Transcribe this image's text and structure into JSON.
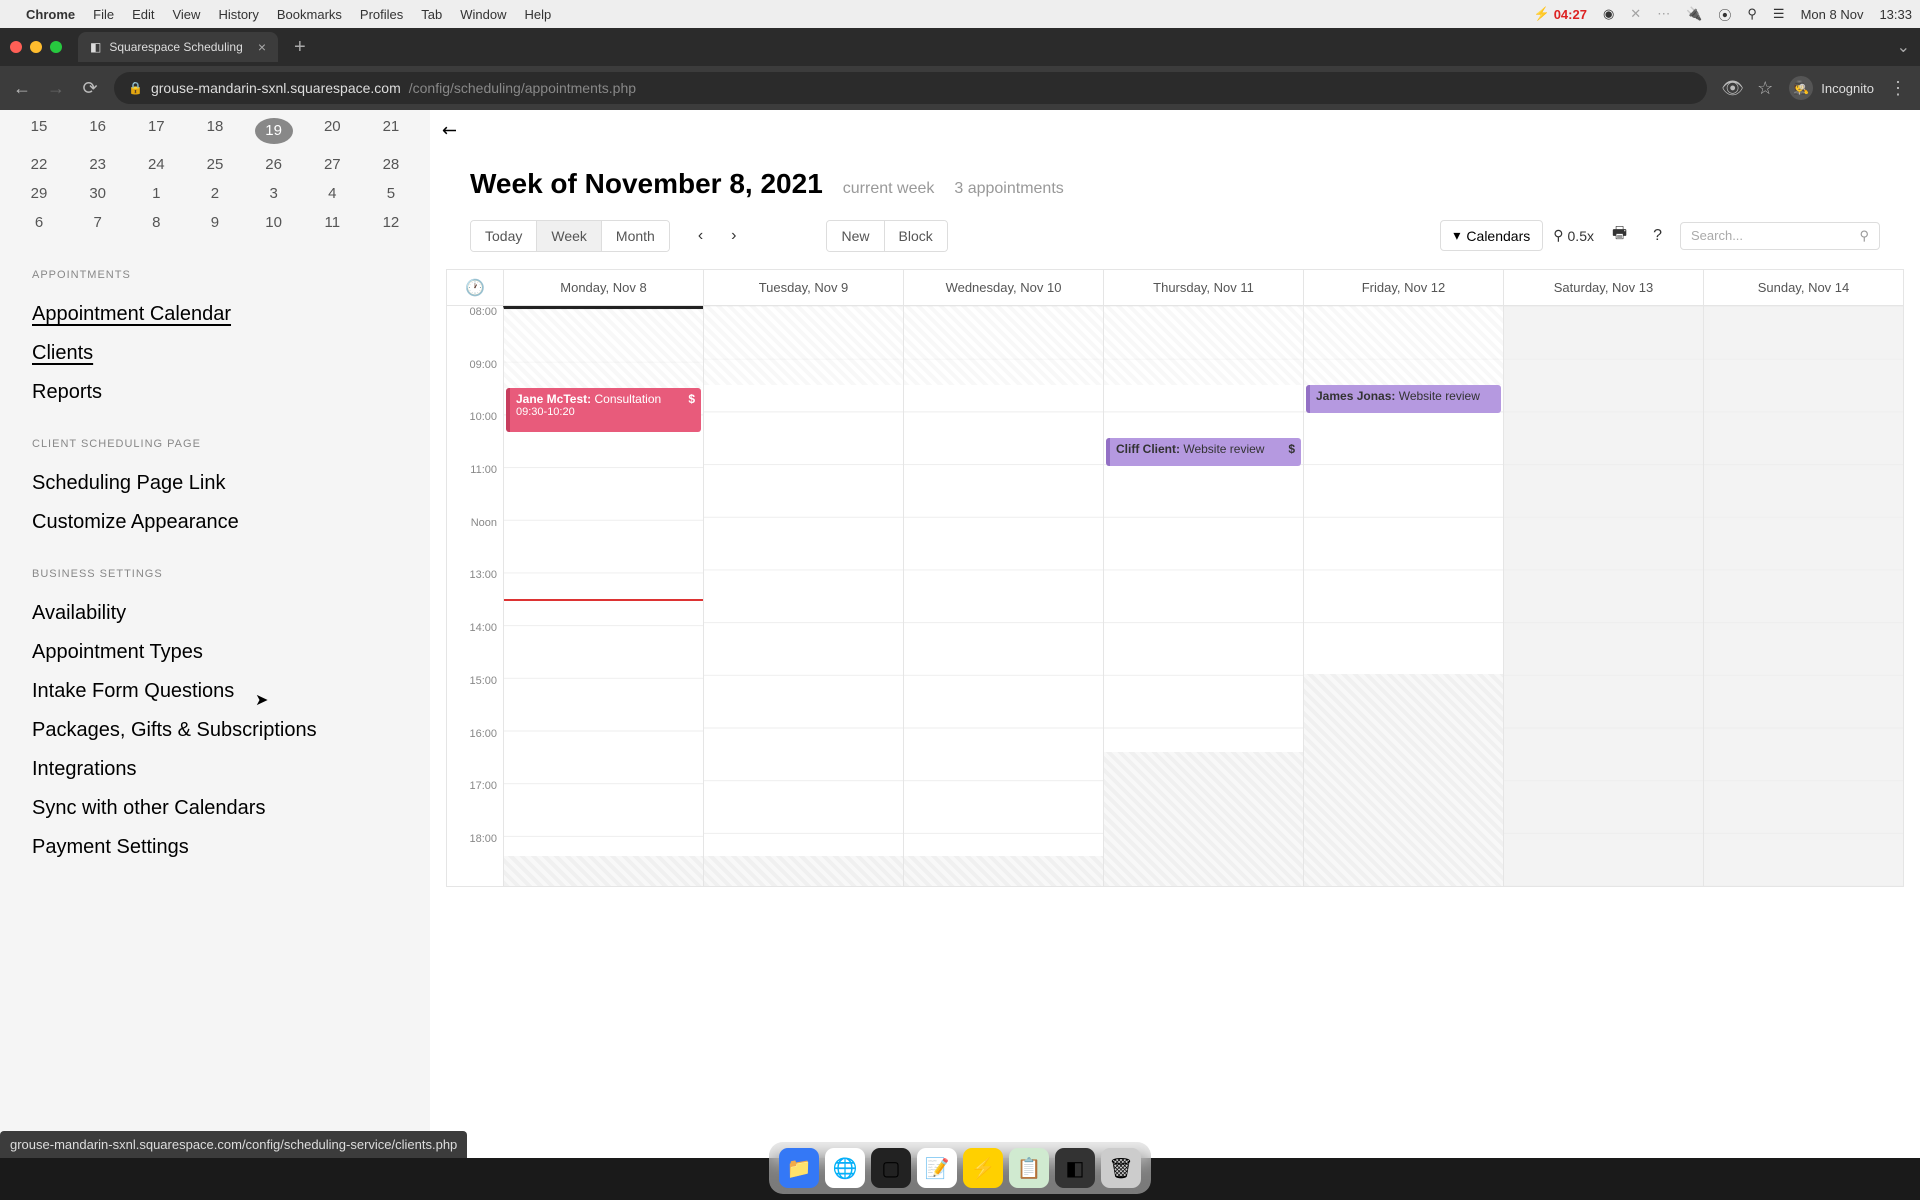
{
  "menubar": {
    "app": "Chrome",
    "items": [
      "File",
      "Edit",
      "View",
      "History",
      "Bookmarks",
      "Profiles",
      "Tab",
      "Window",
      "Help"
    ],
    "battery_time": "04:27",
    "date": "Mon 8 Nov",
    "clock": "13:33"
  },
  "browser": {
    "tab_title": "Squarespace Scheduling",
    "url_host": "grouse-mandarin-sxnl.squarespace.com",
    "url_path": "/config/scheduling/appointments.php",
    "incognito_label": "Incognito",
    "status_url": "grouse-mandarin-sxnl.squarespace.com/config/scheduling-service/clients.php"
  },
  "sidebar": {
    "mini_cal": [
      [
        "15",
        "16",
        "17",
        "18",
        "19",
        "20",
        "21"
      ],
      [
        "22",
        "23",
        "24",
        "25",
        "26",
        "27",
        "28"
      ],
      [
        "29",
        "30",
        "1",
        "2",
        "3",
        "4",
        "5"
      ],
      [
        "6",
        "7",
        "8",
        "9",
        "10",
        "11",
        "12"
      ]
    ],
    "mini_cal_today": "19",
    "sections": [
      {
        "title": "APPOINTMENTS",
        "items": [
          "Appointment Calendar",
          "Clients",
          "Reports"
        ]
      },
      {
        "title": "CLIENT SCHEDULING PAGE",
        "items": [
          "Scheduling Page Link",
          "Customize Appearance"
        ]
      },
      {
        "title": "BUSINESS SETTINGS",
        "items": [
          "Availability",
          "Appointment Types",
          "Intake Form Questions",
          "Packages, Gifts & Subscriptions",
          "Integrations",
          "Sync with other Calendars",
          "Payment Settings"
        ]
      }
    ],
    "active": [
      "Appointment Calendar",
      "Clients"
    ]
  },
  "main": {
    "title": "Week of November 8, 2021",
    "subtitle_current": "current week",
    "subtitle_count": "3 appointments",
    "toolbar": {
      "today": "Today",
      "week": "Week",
      "month": "Month",
      "new": "New",
      "block": "Block",
      "calendars": "Calendars",
      "zoom": "0.5x",
      "search_placeholder": "Search..."
    },
    "days": [
      "Monday, Nov 8",
      "Tuesday, Nov 9",
      "Wednesday, Nov 10",
      "Thursday, Nov 11",
      "Friday, Nov 12",
      "Saturday, Nov 13",
      "Sunday, Nov 14"
    ],
    "times": [
      "08:00",
      "09:00",
      "10:00",
      "11:00",
      "Noon",
      "13:00",
      "14:00",
      "15:00",
      "16:00",
      "17:00",
      "18:00"
    ],
    "events": [
      {
        "day": 0,
        "class": "pink",
        "client": "Jane McTest:",
        "title": "Consultation",
        "time": "09:30-10:20",
        "dollar": "$"
      },
      {
        "day": 3,
        "class": "purple1",
        "client": "Cliff Client:",
        "title": "Website review",
        "dollar": "$"
      },
      {
        "day": 4,
        "class": "purple2",
        "client": "James Jonas:",
        "title": "Website review"
      }
    ],
    "off_bottom_h": {
      "0": "30",
      "1": "30",
      "2": "30",
      "3": "134",
      "4": "212"
    }
  }
}
